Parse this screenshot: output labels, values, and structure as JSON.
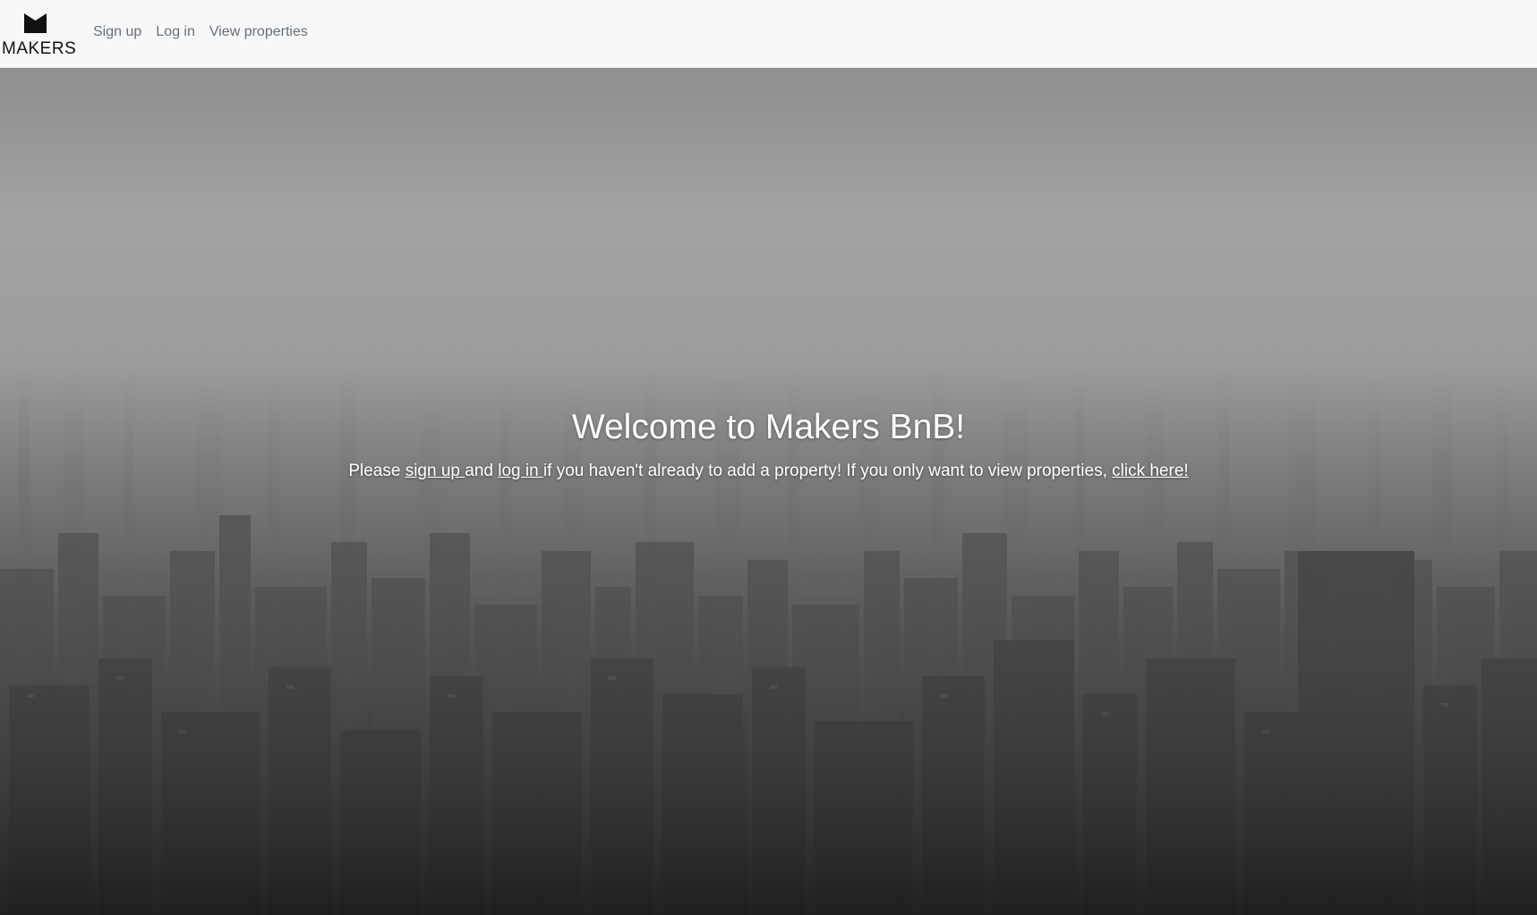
{
  "brand": {
    "name": "MAKERS"
  },
  "nav": {
    "items": [
      {
        "label": "Sign up"
      },
      {
        "label": "Log in"
      },
      {
        "label": "View properties"
      }
    ]
  },
  "hero": {
    "title": "Welcome to Makers BnB!",
    "text_prefix": "Please ",
    "signup_link": "sign up ",
    "text_and": "and ",
    "login_link": "log in ",
    "text_middle": "if you haven't already to add a property! If you only want to view properties, ",
    "click_link": "click here!"
  },
  "colors": {
    "navbar_bg": "#f7f8f9",
    "nav_link": "#6b6f73",
    "hero_text": "#ffffff"
  }
}
